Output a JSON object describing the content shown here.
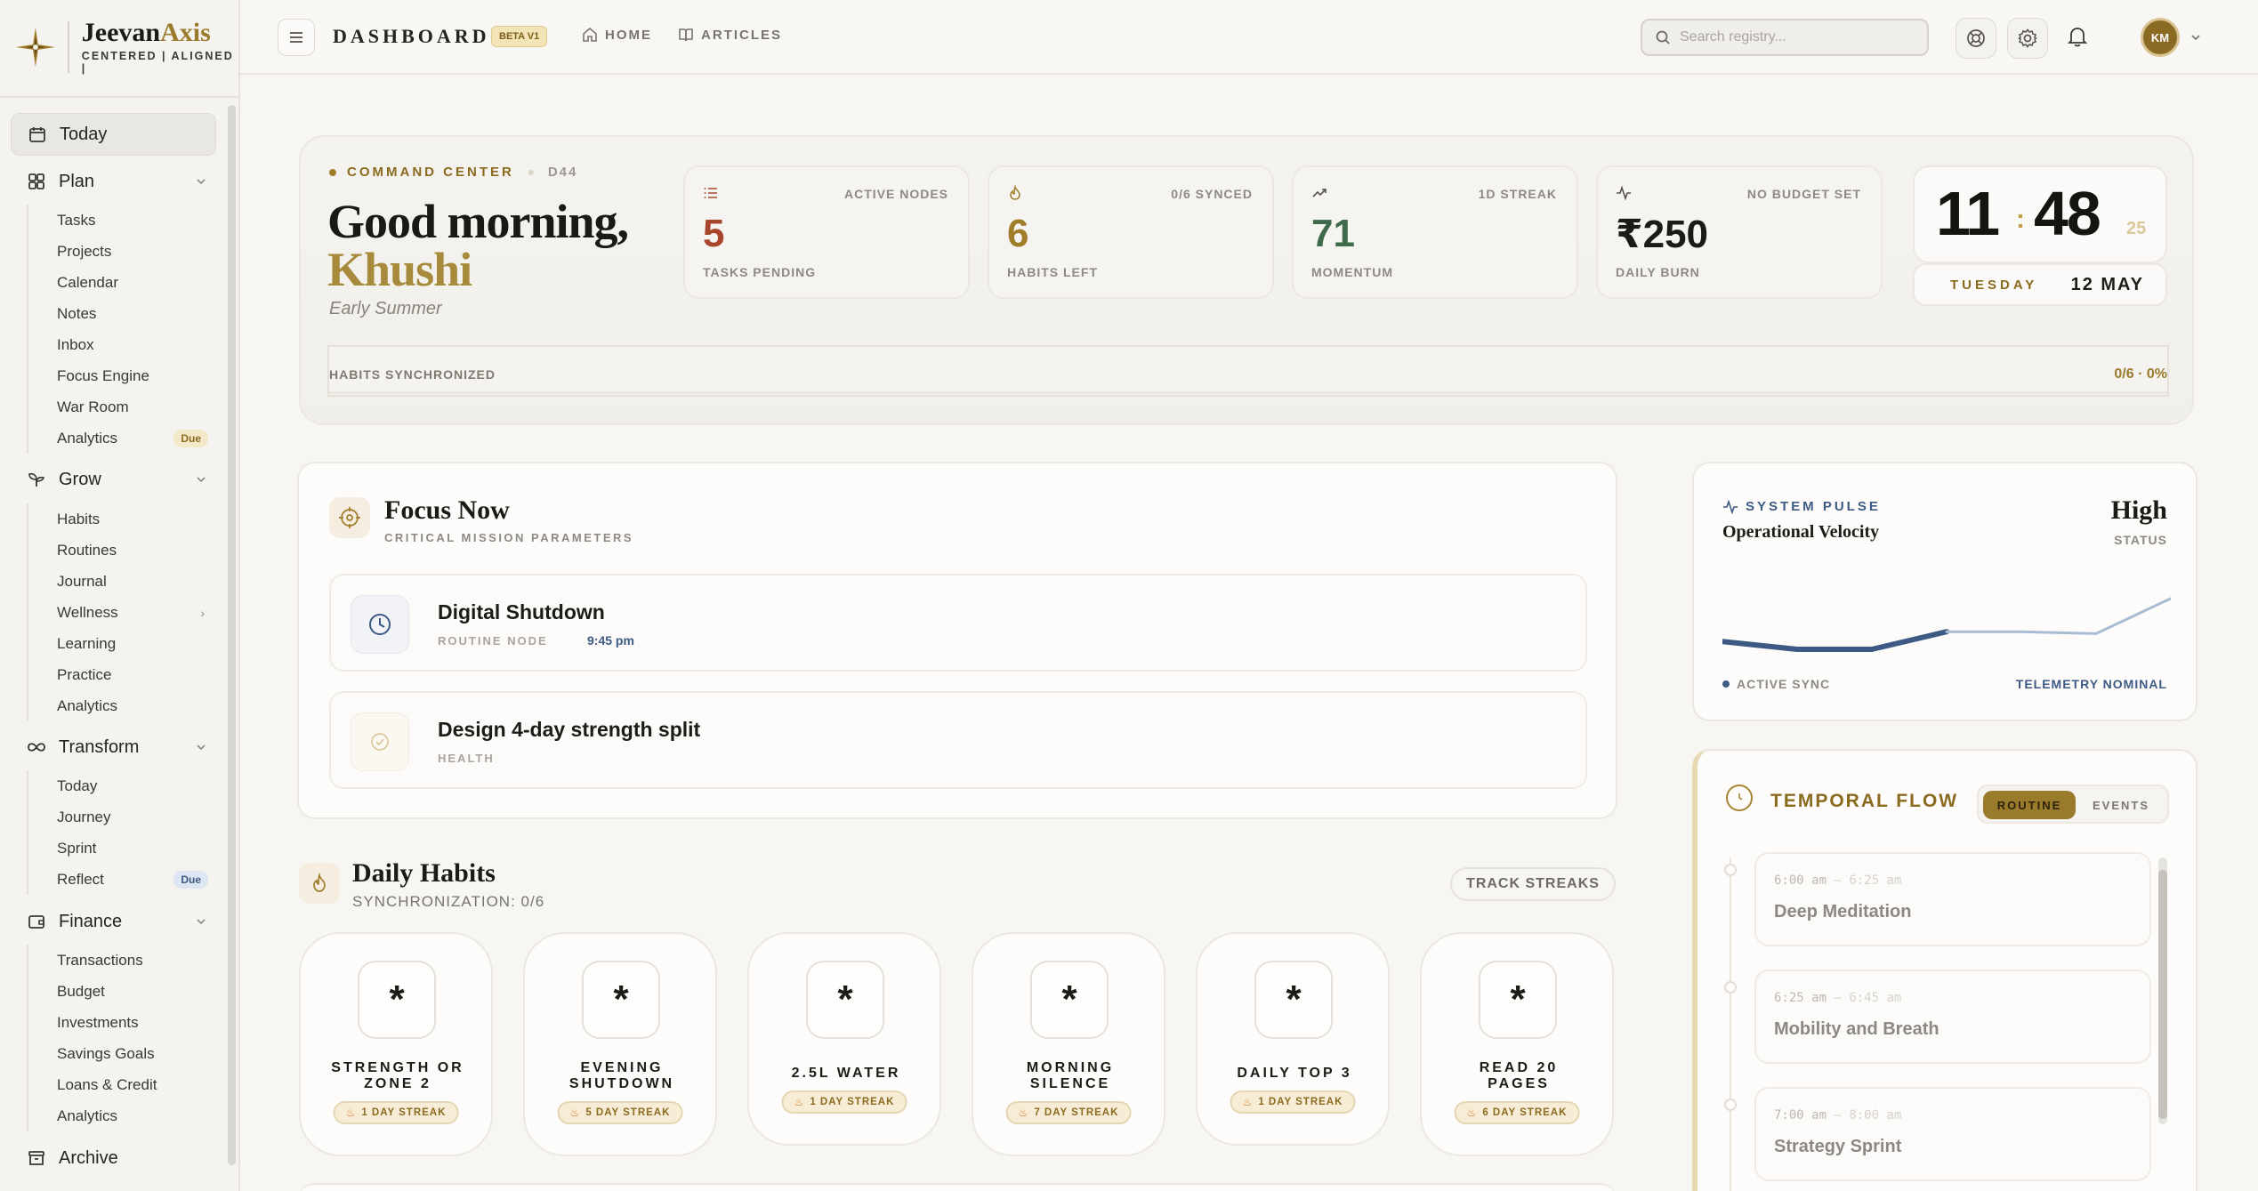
{
  "brand": {
    "name_a": "Jeevan",
    "name_b": "Axis",
    "tagline": "CENTERED | ALIGNED |"
  },
  "sidebar": {
    "today": "Today",
    "plan": {
      "label": "Plan",
      "items": [
        "Tasks",
        "Projects",
        "Calendar",
        "Notes",
        "Inbox",
        "Focus Engine",
        "War Room",
        "Analytics"
      ],
      "analytics_badge": "Due"
    },
    "grow": {
      "label": "Grow",
      "items": [
        "Habits",
        "Routines",
        "Journal",
        "Wellness",
        "Learning",
        "Practice",
        "Analytics"
      ]
    },
    "transform": {
      "label": "Transform",
      "items": [
        "Today",
        "Journey",
        "Sprint",
        "Reflect"
      ],
      "reflect_badge": "Due"
    },
    "finance": {
      "label": "Finance",
      "items": [
        "Transactions",
        "Budget",
        "Investments",
        "Savings Goals",
        "Loans & Credit",
        "Analytics"
      ]
    },
    "archive": "Archive"
  },
  "topbar": {
    "title": "DASHBOARD",
    "beta": "BETA V1",
    "home": "HOME",
    "articles": "ARTICLES",
    "search_placeholder": "Search registry...",
    "avatar_initials": "KM"
  },
  "command": {
    "label": "COMMAND CENTER",
    "day": "D44",
    "greeting": "Good morning,",
    "name": "Khushi",
    "season": "Early Summer",
    "stats": [
      {
        "top": "ACTIVE NODES",
        "value": "5",
        "label": "TASKS PENDING",
        "color": "#a8452d",
        "icon": "list-icon"
      },
      {
        "top": "0/6 SYNCED",
        "value": "6",
        "label": "HABITS LEFT",
        "color": "#a07d2b",
        "icon": "flame-icon"
      },
      {
        "top": "1D STREAK",
        "value": "71",
        "label": "MOMENTUM",
        "color": "#3f6b4a",
        "icon": "trending-icon"
      },
      {
        "top": "NO BUDGET SET",
        "value": "₹250",
        "label": "DAILY BURN",
        "color": "#1c1a16",
        "icon": "pulse-icon"
      }
    ],
    "clock": {
      "hours": "11",
      "minutes": "48",
      "seconds": "25"
    },
    "date": {
      "weekday": "TUESDAY",
      "day_month": "12 MAY"
    },
    "sync": {
      "label": "HABITS SYNCHRONIZED",
      "value": "0/6 · 0%",
      "progress": 0
    }
  },
  "focus": {
    "title": "Focus Now",
    "subtitle": "CRITICAL MISSION PARAMETERS",
    "tasks": [
      {
        "title": "Digital Shutdown",
        "meta": "ROUTINE NODE",
        "time": "9:45 pm"
      },
      {
        "title": "Design 4-day strength split",
        "meta": "HEALTH",
        "time": ""
      }
    ]
  },
  "habits": {
    "title": "Daily Habits",
    "subtitle": "SYNCHRONIZATION: 0/6",
    "track_button": "TRACK STREAKS",
    "icon_glyph": "*",
    "items": [
      {
        "name_1": "STRENGTH OR",
        "name_2": "ZONE 2",
        "streak": "1 DAY STREAK"
      },
      {
        "name_1": "EVENING",
        "name_2": "SHUTDOWN",
        "streak": "5 DAY STREAK"
      },
      {
        "name_1": "2.5L WATER",
        "name_2": "",
        "streak": "1 DAY STREAK"
      },
      {
        "name_1": "MORNING",
        "name_2": "SILENCE",
        "streak": "7 DAY STREAK"
      },
      {
        "name_1": "DAILY TOP 3",
        "name_2": "",
        "streak": "1 DAY STREAK"
      },
      {
        "name_1": "READ 20",
        "name_2": "PAGES",
        "streak": "6 DAY STREAK"
      }
    ]
  },
  "pulse": {
    "label": "SYSTEM PULSE",
    "title": "Operational Velocity",
    "value": "High",
    "status": "STATUS",
    "foot_left": "ACTIVE SYNC",
    "foot_right": "TELEMETRY NOMINAL",
    "line_color": "#3d5a84",
    "velocity": [
      0.18,
      0.1,
      0.1,
      0.28,
      0.28,
      0.26,
      0.62
    ]
  },
  "temporal": {
    "title": "TEMPORAL FLOW",
    "tab_routine": "ROUTINE",
    "tab_events": "EVENTS",
    "items": [
      {
        "start": "6:00 am",
        "end": "6:25 am",
        "name": "Deep Meditation"
      },
      {
        "start": "6:25 am",
        "end": "6:45 am",
        "name": "Mobility and Breath"
      },
      {
        "start": "7:00 am",
        "end": "8:00 am",
        "name": "Strategy Sprint"
      }
    ]
  },
  "colors": {
    "gold": "#9a7a2b",
    "navy": "#3d5a84",
    "bg": "#f7f6f3"
  }
}
